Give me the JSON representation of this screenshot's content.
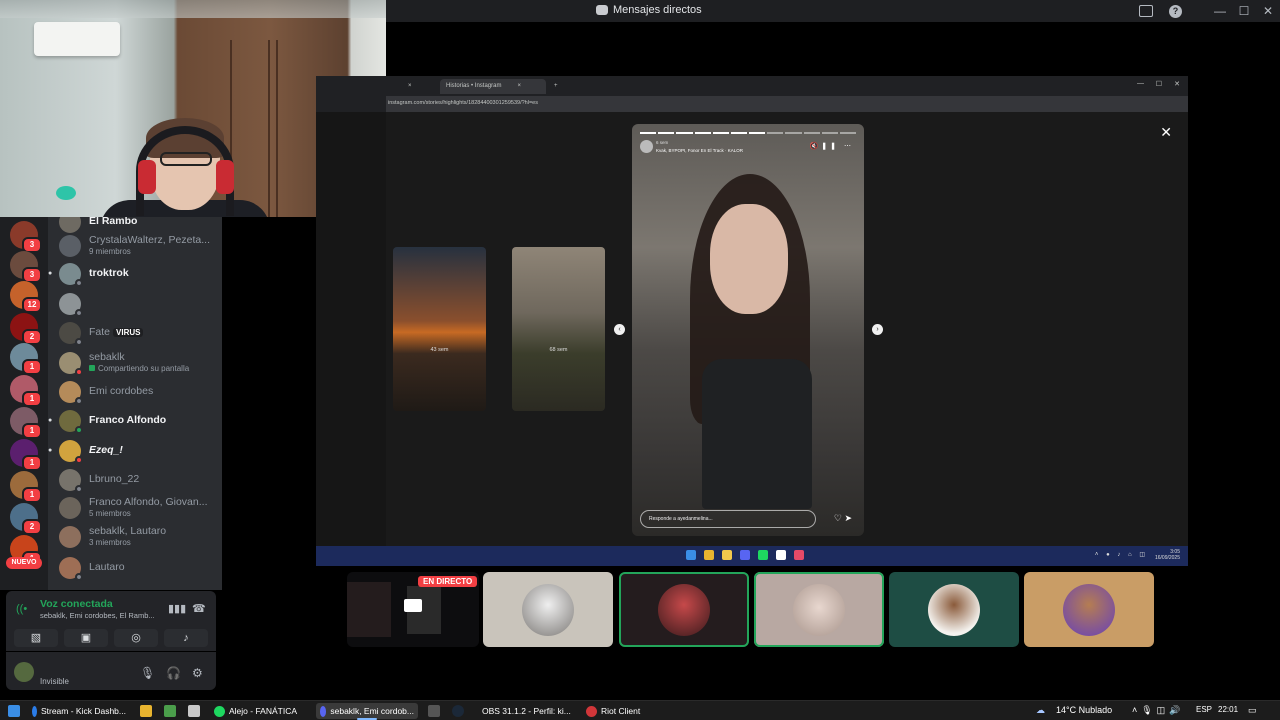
{
  "window": {
    "title": "Mensajes directos",
    "controls": [
      "—",
      "☐",
      "✕"
    ]
  },
  "dm_list": [
    {
      "name": "El Rambo",
      "style": "bright",
      "cut": true
    },
    {
      "name": "CrystalaWalterz, Pezeta...",
      "sub": "9 miembros",
      "style": "dim"
    },
    {
      "name": "troktrok",
      "style": "bright",
      "arrow": true
    },
    {
      "name": "",
      "style": "dim"
    },
    {
      "name": "Fate",
      "tag": "VIRUS",
      "style": "dim"
    },
    {
      "name": "sebaklk",
      "sub": "Compartiendo su pantalla",
      "style": "dim"
    },
    {
      "name": "Emi cordobes",
      "style": "dim"
    },
    {
      "name": "Franco Alfondo",
      "style": "bright",
      "arrow": true
    },
    {
      "name": "Ezeq_!",
      "style": "bright italic",
      "arrow": true
    },
    {
      "name": "Lbruno_22",
      "style": "dim"
    },
    {
      "name": "Franco Alfondo, Giovan...",
      "sub": "5 miembros",
      "style": "dim"
    },
    {
      "name": "sebaklk, Lautaro",
      "sub": "3 miembros",
      "style": "dim"
    },
    {
      "name": "Lautaro",
      "style": "dim"
    }
  ],
  "guild_badges": [
    "3",
    "3",
    "12",
    "2",
    "1",
    "1",
    "1",
    "1",
    "1",
    "2",
    "1"
  ],
  "nuevo_label": "NUEVO",
  "voice": {
    "title": "Voz conectada",
    "members": "sebaklk, Emi cordobes, El Ramb..."
  },
  "user": {
    "status": "Invisible"
  },
  "browser": {
    "tabs": [
      {
        "label": "",
        "close": "×"
      },
      {
        "label": "Historias • Instagram",
        "close": "×"
      }
    ],
    "new_tab": "+",
    "url": "instagram.com/stories/highlights/18284400301259539/?hl=es"
  },
  "stories": {
    "prev1_time": "43 sem",
    "prev2_time": "68 sem",
    "main_time": "6 sem",
    "main_song": "Kvak, BYPOPI, Fonor En El Track · KALOR",
    "reply_placeholder": "Responde a ayedanmelina...",
    "close": "✕",
    "nav_left": "‹",
    "nav_right": "›"
  },
  "remote_clock": {
    "time": "3:05",
    "date": "16/09/2025"
  },
  "live_label": "EN DIRECTO",
  "taskbar": {
    "items": [
      {
        "label": "Stream - Kick Dashb...",
        "color": "#2b7de9"
      },
      {
        "label": "Alejo - FANÁTICA",
        "color": "#1ed760"
      },
      {
        "label": "sebaklk, Emi cordob...",
        "color": "#5865f2"
      },
      {
        "label": "OBS 31.1.2 - Perfil: ki...",
        "color": "#8b8b8b"
      },
      {
        "label": "Riot Client",
        "color": "#d13639"
      }
    ],
    "weather": "14°C  Nublado",
    "lang": "ESP",
    "time": "22:01"
  }
}
